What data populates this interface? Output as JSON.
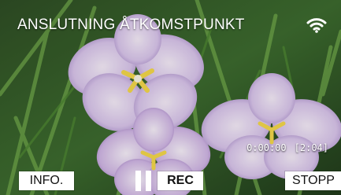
{
  "title": "ANSLUTNING ÅTKOMSTPUNKT",
  "icons": {
    "wifi": "wifi-icon",
    "pause": "pause-icon"
  },
  "timecode": {
    "elapsed": "0:00:00",
    "remaining": "[2:04]"
  },
  "buttons": {
    "info": "INFO.",
    "rec": "REC",
    "stop": "STOPP"
  },
  "colors": {
    "button_bg": "#ffffff",
    "text_overlay": "#ffffff"
  }
}
